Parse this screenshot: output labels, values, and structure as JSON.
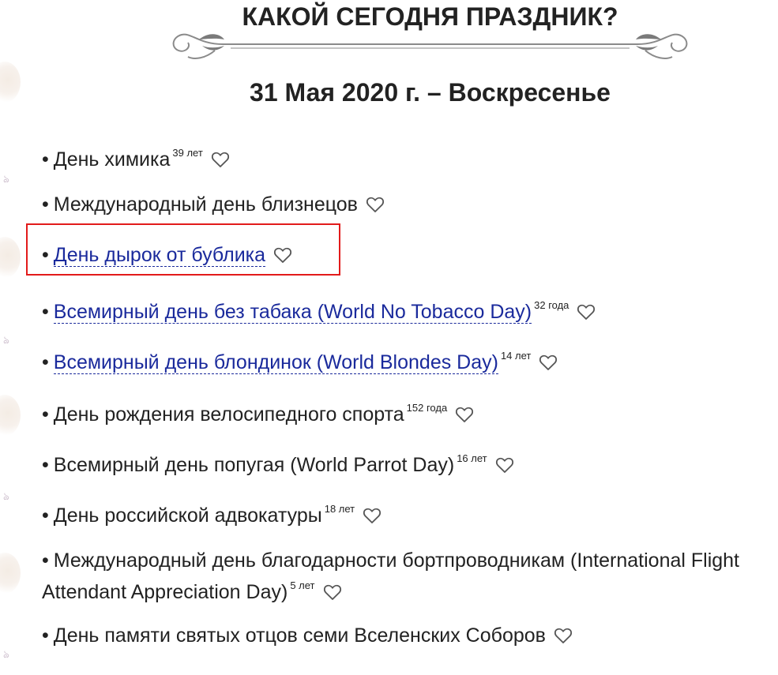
{
  "page": {
    "title": "КАКОЙ СЕГОДНЯ ПРАЗДНИК?",
    "date": "31 Мая 2020 г. – Воскресенье"
  },
  "holidays": [
    {
      "bullet": "•",
      "name": "День химика",
      "years": "39 лет",
      "link": false
    },
    {
      "bullet": "•",
      "name": "Международный день близнецов",
      "years": "",
      "link": false
    },
    {
      "bullet": "•",
      "name": "День дырок от бублика",
      "years": "",
      "link": true
    },
    {
      "bullet": "•",
      "name": "Всемирный день без табака (World No Tobacco Day)",
      "years": "32 года",
      "link": true
    },
    {
      "bullet": "•",
      "name": "Всемирный день блондинок (World Blondes Day)",
      "years": "14 лет",
      "link": true
    },
    {
      "bullet": "•",
      "name": "День рождения велосипедного спорта",
      "years": "152 года",
      "link": false
    },
    {
      "bullet": "•",
      "name": "Всемирный день попугая (World Parrot Day)",
      "years": "16 лет",
      "link": false
    },
    {
      "bullet": "•",
      "name": "День российской адвокатуры",
      "years": "18 лет",
      "link": false
    },
    {
      "bullet": "•",
      "name": "Международный день благодарности бортпроводникам (International Flight Attendant Appreciation Day)",
      "years": "5 лет",
      "link": false
    },
    {
      "bullet": "•",
      "name": "День памяти святых отцов семи Вселенских Соборов",
      "years": "",
      "link": false
    }
  ],
  "icons": {
    "favorite": "heart-outline-icon",
    "ornament": "ornamental-divider"
  },
  "colors": {
    "link": "#1a2a9c",
    "text": "#222222",
    "highlight": "#e21b1b",
    "ornament": "#8a8a8a"
  }
}
